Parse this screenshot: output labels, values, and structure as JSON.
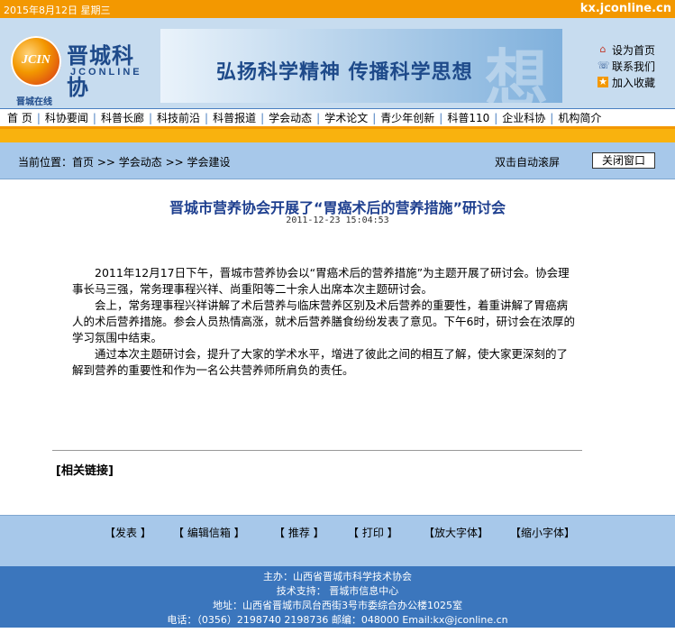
{
  "topbar": {
    "date": "2015年8月12日  星期三",
    "domain": "kx.jconline.cn"
  },
  "header": {
    "logo_mark": "JCIN",
    "logo_title": "晋城科协",
    "logo_sub": "JCONLINE",
    "logo_cn": "晋城在线",
    "slogan": "弘扬科学精神  传播科学思想",
    "slogan_bg_char": "想",
    "quick_links": [
      {
        "label": "设为首页",
        "icon": "home-icon"
      },
      {
        "label": "联系我们",
        "icon": "contact-icon"
      },
      {
        "label": "加入收藏",
        "icon": "star-icon"
      }
    ]
  },
  "nav": {
    "items": [
      "首 页",
      "科协要闻",
      "科普长廊",
      "科技前沿",
      "科普报道",
      "学会动态",
      "学术论文",
      "青少年创新",
      "科普110",
      "企业科协",
      "机构简介"
    ]
  },
  "crumb": {
    "label": "当前位置：",
    "path": "首页 >> 学会动态 >> 学会建设",
    "scroll": "双击自动滚屏",
    "close": "关闭窗口"
  },
  "article": {
    "title": "晋城市营养协会开展了“胃癌术后的营养措施”研讨会",
    "time": "2011-12-23 15:04:53",
    "paragraphs": [
      "2011年12月17日下午，晋城市营养协会以“胃癌术后的营养措施”为主题开展了研讨会。协会理事长马三强，常务理事程兴祥、尚重阳等二十余人出席本次主题研讨会。",
      "会上，常务理事程兴祥讲解了术后营养与临床营养区别及术后营养的重要性，着重讲解了胃癌病人的术后营养措施。参会人员热情高涨，就术后营养膳食纷纷发表了意见。下午6时，研讨会在浓厚的学习氛围中结束。",
      "通过本次主题研讨会，提升了大家的学术水平，增进了彼此之间的相互了解，使大家更深刻的了解到营养的重要性和作为一名公共营养师所肩负的责任。"
    ],
    "related": "[相关链接]"
  },
  "tools": [
    "【发表 】",
    "【 编辑信箱 】",
    "【 推荐 】",
    "【 打印 】",
    "【放大字体】",
    "【缩小字体】"
  ],
  "footer": {
    "sponsor": "主办：山西省晋城市科学技术协会",
    "support": "技术支持：        晋城市信息中心",
    "address": "地址：山西省晋城市凤台西街3号市委综合办公楼1025室",
    "contact": "电话：（0356）2198740  2198736      邮编：048000      Email:kx@jconline.cn"
  },
  "colors": {
    "orange": "#f39800",
    "blue": "#3b76bd",
    "light_blue": "#a7c8ea",
    "title_blue": "#1e3f8f"
  }
}
